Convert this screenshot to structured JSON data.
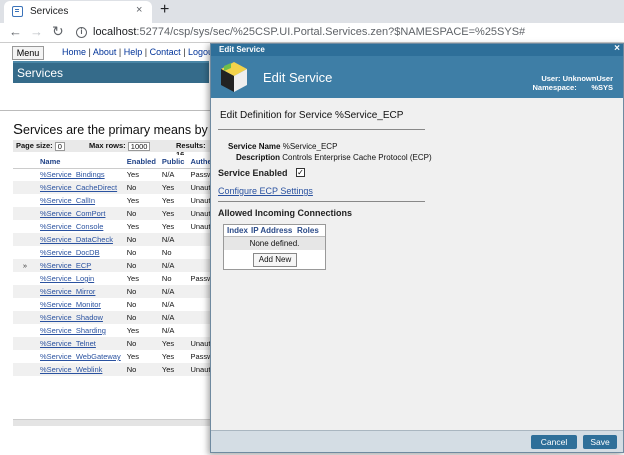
{
  "browser": {
    "tab_title": "Services",
    "tab_close": "×",
    "new_tab": "+",
    "url_host": "localhost",
    "url_path": ":52774/csp/sys/sec/%25CSP.UI.Portal.Services.zen?$NAMESPACE=%25SYS#"
  },
  "page": {
    "menu_label": "Menu",
    "links": [
      "Home",
      "About",
      "Help",
      "Contact",
      "Logout"
    ],
    "title": "Services",
    "intro_cap": "S",
    "intro_rest": "ervices are the primary means by which us",
    "pager": {
      "page_size_label": "Page size:",
      "page_size_value": "0",
      "max_rows_label": "Max rows:",
      "max_rows_value": "1000",
      "results_label": "Results: 16"
    },
    "table": {
      "headers": [
        "",
        "Name",
        "Enabled",
        "Public",
        "Authent"
      ],
      "rows": [
        {
          "marker": "",
          "name": "%Service_Bindings",
          "enabled": "Yes",
          "public": "N/A",
          "auth": "Passwo"
        },
        {
          "marker": "",
          "name": "%Service_CacheDirect",
          "enabled": "No",
          "public": "Yes",
          "auth": "Unauthe"
        },
        {
          "marker": "",
          "name": "%Service_CallIn",
          "enabled": "Yes",
          "public": "Yes",
          "auth": "Unauthe"
        },
        {
          "marker": "",
          "name": "%Service_ComPort",
          "enabled": "No",
          "public": "Yes",
          "auth": "Unauthe"
        },
        {
          "marker": "",
          "name": "%Service_Console",
          "enabled": "Yes",
          "public": "Yes",
          "auth": "Unauthe"
        },
        {
          "marker": "",
          "name": "%Service_DataCheck",
          "enabled": "No",
          "public": "N/A",
          "auth": ""
        },
        {
          "marker": "",
          "name": "%Service_DocDB",
          "enabled": "No",
          "public": "No",
          "auth": ""
        },
        {
          "marker": "»",
          "name": "%Service_ECP",
          "enabled": "No",
          "public": "N/A",
          "auth": ""
        },
        {
          "marker": "",
          "name": "%Service_Login",
          "enabled": "Yes",
          "public": "No",
          "auth": "Passwo"
        },
        {
          "marker": "",
          "name": "%Service_Mirror",
          "enabled": "No",
          "public": "N/A",
          "auth": ""
        },
        {
          "marker": "",
          "name": "%Service_Monitor",
          "enabled": "No",
          "public": "N/A",
          "auth": ""
        },
        {
          "marker": "",
          "name": "%Service_Shadow",
          "enabled": "No",
          "public": "N/A",
          "auth": ""
        },
        {
          "marker": "",
          "name": "%Service_Sharding",
          "enabled": "Yes",
          "public": "N/A",
          "auth": ""
        },
        {
          "marker": "",
          "name": "%Service_Telnet",
          "enabled": "No",
          "public": "Yes",
          "auth": "Unauthe"
        },
        {
          "marker": "",
          "name": "%Service_WebGateway",
          "enabled": "Yes",
          "public": "Yes",
          "auth": "Passwo"
        },
        {
          "marker": "",
          "name": "%Service_Weblink",
          "enabled": "No",
          "public": "Yes",
          "auth": "Unauthe"
        }
      ]
    }
  },
  "modal": {
    "titlebar": "Edit Service",
    "close": "×",
    "header_title": "Edit Service",
    "user_label": "User: UnknownUser",
    "namespace_label": "Namespace:",
    "namespace_value": "%SYS",
    "definition_title": "Edit Definition for Service %Service_ECP",
    "service_name_label": "Service Name",
    "service_name_value": "%Service_ECP",
    "description_label": "Description",
    "description_value": "Controls Enterprise Cache Protocol (ECP)",
    "enabled_label": "Service Enabled",
    "enabled_checked": "✓",
    "configure_link": "Configure ECP Settings",
    "allowed_title": "Allowed Incoming Connections",
    "conn_headers": [
      "Index",
      "IP Address",
      "Roles"
    ],
    "conn_empty": "None defined.",
    "add_new": "Add New",
    "cancel": "Cancel",
    "save": "Save"
  }
}
